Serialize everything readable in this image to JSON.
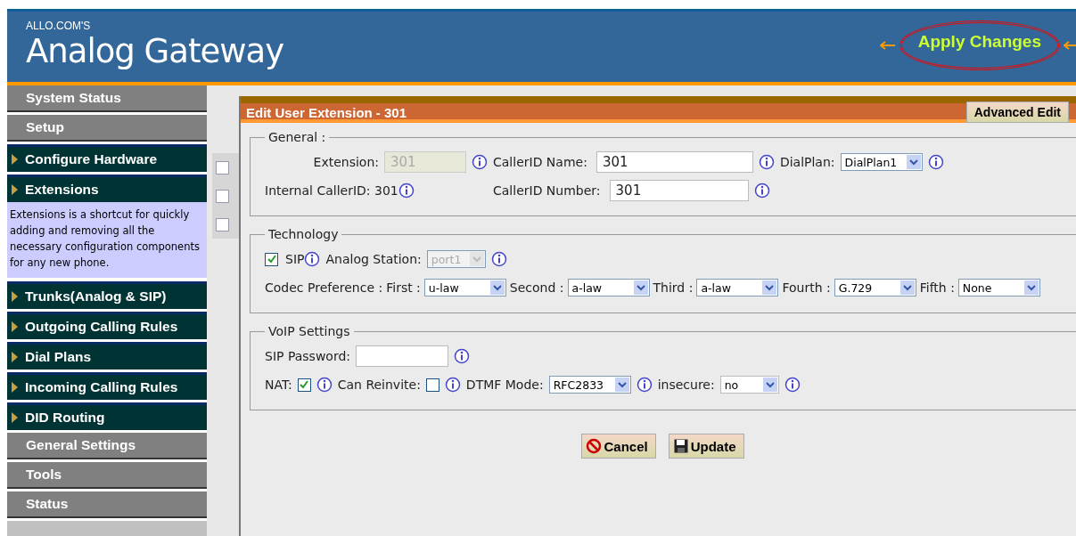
{
  "header": {
    "brand": "ALLO.COM'S",
    "title": "Analog Gateway",
    "apply_changes": "Apply Changes"
  },
  "sidebar": {
    "items": [
      {
        "label": "System Status",
        "kind": "section"
      },
      {
        "label": "Setup",
        "kind": "section"
      },
      {
        "label": "Configure Hardware",
        "kind": "link"
      },
      {
        "label": "Extensions",
        "kind": "link",
        "description": "Extensions is a shortcut for quickly adding and removing all the necessary configuration components for any new phone."
      },
      {
        "label": "Trunks(Analog & SIP)",
        "kind": "link"
      },
      {
        "label": "Outgoing Calling Rules",
        "kind": "link"
      },
      {
        "label": "Dial Plans",
        "kind": "link"
      },
      {
        "label": "Incoming Calling Rules",
        "kind": "link"
      },
      {
        "label": "DID Routing",
        "kind": "link"
      },
      {
        "label": "General Settings",
        "kind": "section"
      },
      {
        "label": "Tools",
        "kind": "section"
      },
      {
        "label": "Status",
        "kind": "section"
      }
    ]
  },
  "background_rows": [
    {
      "checked": false
    },
    {
      "checked": false
    },
    {
      "checked": false
    }
  ],
  "dialog": {
    "title": "Edit User Extension - 301",
    "advanced_edit": "Advanced Edit",
    "general": {
      "legend": "General :",
      "extension": {
        "label": "Extension:",
        "value": "301",
        "disabled": true
      },
      "callerid_name": {
        "label": "CallerID Name:",
        "value": "301"
      },
      "dialplan": {
        "label": "DialPlan:",
        "value": "DialPlan1"
      },
      "internal_callerid": {
        "label": "Internal CallerID:",
        "value": "301"
      },
      "callerid_number": {
        "label": "CallerID Number:",
        "value": "301"
      }
    },
    "technology": {
      "legend": "Technology",
      "sip": {
        "label": "SIP",
        "checked": true
      },
      "analog_station": {
        "label": "Analog Station:",
        "value": "port1",
        "disabled": true
      },
      "codec_label": "Codec Preference :",
      "codecs": [
        {
          "label": "First :",
          "value": "u-law"
        },
        {
          "label": "Second :",
          "value": "a-law"
        },
        {
          "label": "Third :",
          "value": "a-law"
        },
        {
          "label": "Fourth :",
          "value": "G.729"
        },
        {
          "label": "Fifth :",
          "value": "None"
        }
      ]
    },
    "voip": {
      "legend": "VoIP Settings",
      "sip_password": {
        "label": "SIP Password:"
      },
      "nat": {
        "label": "NAT:",
        "checked": true
      },
      "can_reinvite": {
        "label": "Can Reinvite:",
        "checked": false
      },
      "dtmf_mode": {
        "label": "DTMF Mode:",
        "value": "RFC2833"
      },
      "insecure": {
        "label": "insecure:",
        "value": "no"
      }
    },
    "buttons": [
      {
        "label": "Cancel",
        "kind": "cancel"
      },
      {
        "label": "Update",
        "kind": "update"
      }
    ]
  }
}
